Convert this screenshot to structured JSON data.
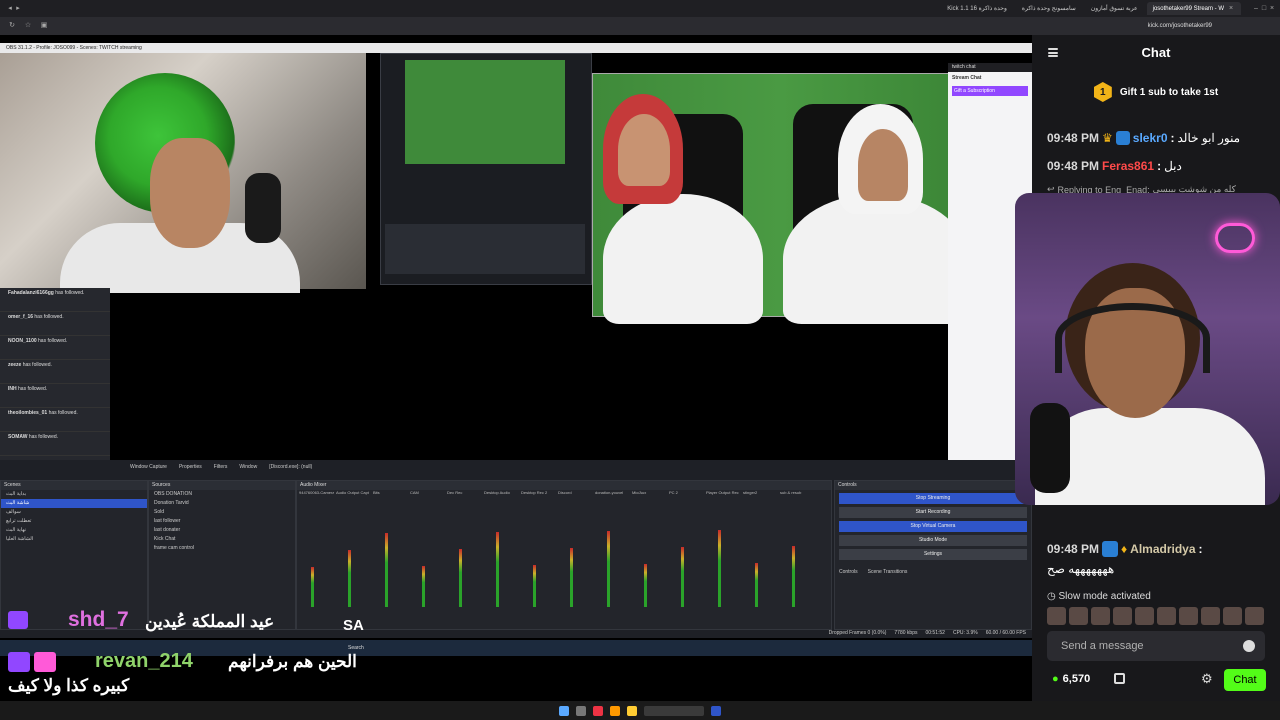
{
  "browser": {
    "tabs": [
      {
        "label": "Kick 1.1 وحدة ذاكرة 16",
        "active": false
      },
      {
        "label": "سامسونج وحدة ذاكرة",
        "active": false
      },
      {
        "label": "عربة تسوق أمازون",
        "active": false
      },
      {
        "label": "josothetaker99 Stream - W",
        "active": true
      }
    ],
    "url": "kick.com/josothetaker99"
  },
  "stream": {
    "obs_title": "OBS 31.1.2 - Profile: JOSO099 - Scenes: TWITCH streaming",
    "twitch_chat_label": "twitch chat",
    "stream_chat_label": "Stream Chat",
    "gift_sub_label": "Gift a Subscription",
    "follow_events": [
      {
        "name": "Fahadalanzi6166gg",
        "text": "has followed."
      },
      {
        "name": "omer_f_16",
        "text": "has followed."
      },
      {
        "name": "NOON_1100",
        "text": "has followed."
      },
      {
        "name": "zeeze",
        "text": "has followed."
      },
      {
        "name": "INH",
        "text": "has followed."
      },
      {
        "name": "theoilombies_01",
        "text": "has followed."
      },
      {
        "name": "SOMAW",
        "text": "has followed."
      }
    ],
    "obs": {
      "scenes_header": "Scenes",
      "scenes": [
        "بداية البث",
        "شاشة البث",
        "سوالف",
        "تعطلت ترابع",
        "نهاية البث",
        "الشاشة العليا"
      ],
      "sources_header": "Sources",
      "sources": [
        "OBS DONATION",
        "Donation Tarvid",
        "Sold",
        "last follower",
        "last donater",
        "Kick Chat",
        "frame cam control"
      ],
      "mixer_header": "Audio Mixer",
      "mixer_channels": [
        "944760063-Camera",
        "Audio Output Capt",
        "Bits",
        "CAM",
        "Dec Rec",
        "Desktop Audio",
        "Desktop Rec 2",
        "Discord",
        "donation-youvel",
        "Mic/Aux",
        "PC 2",
        "Player Output Rec",
        "stinger2",
        "sub & resub"
      ],
      "controls_header": "Controls",
      "controls": [
        "Stop Streaming",
        "Start Recording",
        "Stop Virtual Camera",
        "Studio Mode",
        "Settings"
      ],
      "window_capture": "Window Capture",
      "properties": "Properties",
      "filters": "Filters",
      "window_label": "Window",
      "discord_label": "[Discord.exe]: (null)",
      "tabs_bottom": [
        "Controls",
        "Scene Transitions"
      ],
      "status": "Dropped Frames 0 (0.0%)",
      "kbps": "7780 kbps",
      "uptime": "00:51:52",
      "cpu": "CPU: 3.9%",
      "fps": "60.00 / 60.00 FPS",
      "search": "Search"
    },
    "overlays": {
      "name1": "shd_7",
      "msg1": "عيد المملكة عُيدين",
      "flag1": "SA",
      "name2": "revan_214",
      "msg2": "الحين هم برفرانهم",
      "msg3": "كبيره كذا ولا كيف"
    }
  },
  "chat": {
    "title": "Chat",
    "gift_text": "Gift 1 sub to take 1st",
    "gift_count": "1",
    "messages": [
      {
        "time": "09:48 PM",
        "user": "slekr0",
        "user_color": "#5aa9ff",
        "text": "منور ابو خالد"
      },
      {
        "time": "09:48 PM",
        "user": "Feras861",
        "user_color": "#ff4a4a",
        "text": "دبل"
      }
    ],
    "reply_label": "Replying to Eng_Enad:",
    "reply_text": "كله من شوشت بيبسي",
    "bottom_message": {
      "time": "09:48 PM",
      "user": "Almadridya",
      "user_color": "#d4c9a8",
      "text": "هههههههه صح"
    },
    "slow_mode": "Slow mode activated",
    "send_placeholder": "Send a message",
    "points": "6,570",
    "chat_button": "Chat"
  },
  "colors": {
    "kick_green": "#53fc18",
    "chat_bg": "#18181b",
    "obs_blue": "#2f55c9"
  }
}
